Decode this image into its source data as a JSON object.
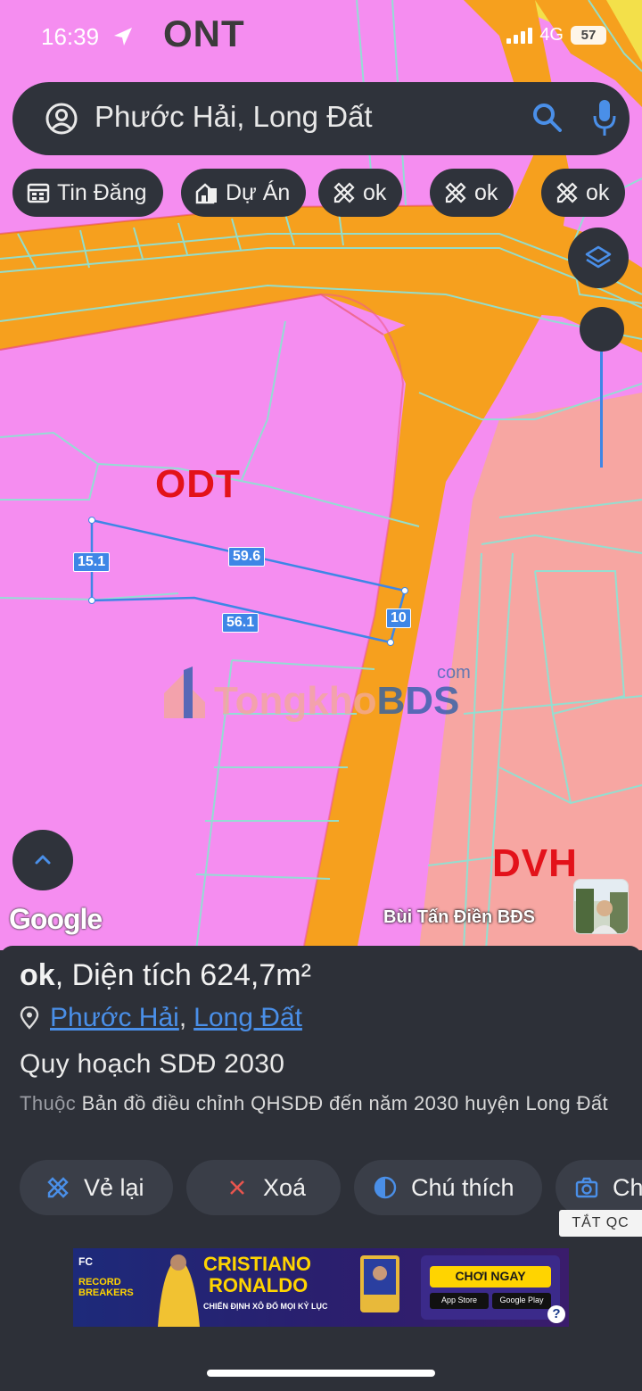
{
  "status_bar": {
    "time": "16:39",
    "network": "4G",
    "battery": "57"
  },
  "map": {
    "zone_labels": {
      "ont": "ONT",
      "odt": "ODT",
      "dvh": "DVH"
    },
    "dimensions": {
      "side_a": "15.1",
      "side_b": "59.6",
      "side_c": "56.1",
      "side_d": "10"
    },
    "watermark": {
      "part1": "Tongkho",
      "part2": "BDS",
      "suffix": "com"
    },
    "google_label": "Google",
    "credit": "Bùi Tấn Điền BĐS",
    "colors": {
      "residential": "#f58df0",
      "road": "#f6a01e",
      "service": "#f7a6a2",
      "lines": "#8fe1d3",
      "parcel": "#3e86e6"
    }
  },
  "search": {
    "text": "Phước Hải, Long Đất"
  },
  "chips": [
    {
      "label": "Tin Đăng",
      "icon": "calendar-icon"
    },
    {
      "label": "Dự Án",
      "icon": "building-icon"
    },
    {
      "label": "ok",
      "icon": "ruler-pencil-icon"
    },
    {
      "label": "ok",
      "icon": "ruler-pencil-icon"
    },
    {
      "label": "ok",
      "icon": "ruler-pencil-icon"
    }
  ],
  "panel": {
    "title_name": "ok",
    "title_rest": ", Diện tích 624,7m²",
    "location": {
      "ward": "Phước Hải",
      "separator": ",",
      "district": "Long Đất"
    },
    "heading": "Quy hoạch SDĐ 2030",
    "desc_prefix": "Thuộc",
    "desc_text": " Bản đồ điều chỉnh QHSDĐ đến năm 2030 huyện Long Đất",
    "actions": [
      {
        "label": "Vẻ lại",
        "icon": "redraw-icon"
      },
      {
        "label": "Xoá",
        "icon": "close-icon"
      },
      {
        "label": "Chú thích",
        "icon": "legend-icon"
      },
      {
        "label": "Ch",
        "icon": "camera-icon"
      }
    ],
    "close_ads": "TẮT QC"
  },
  "ad": {
    "brand": "FC",
    "badge_lines": [
      "RECORD",
      "BREAKERS"
    ],
    "headline_1": "CRISTIANO",
    "headline_2": "RONALDO",
    "tagline": "CHIẾN ĐỊNH XÔ ĐỔ MỌI KỶ LỤC",
    "cta": "CHƠI NGAY",
    "store_1": "App Store",
    "store_2": "Google Play",
    "help": "?"
  }
}
